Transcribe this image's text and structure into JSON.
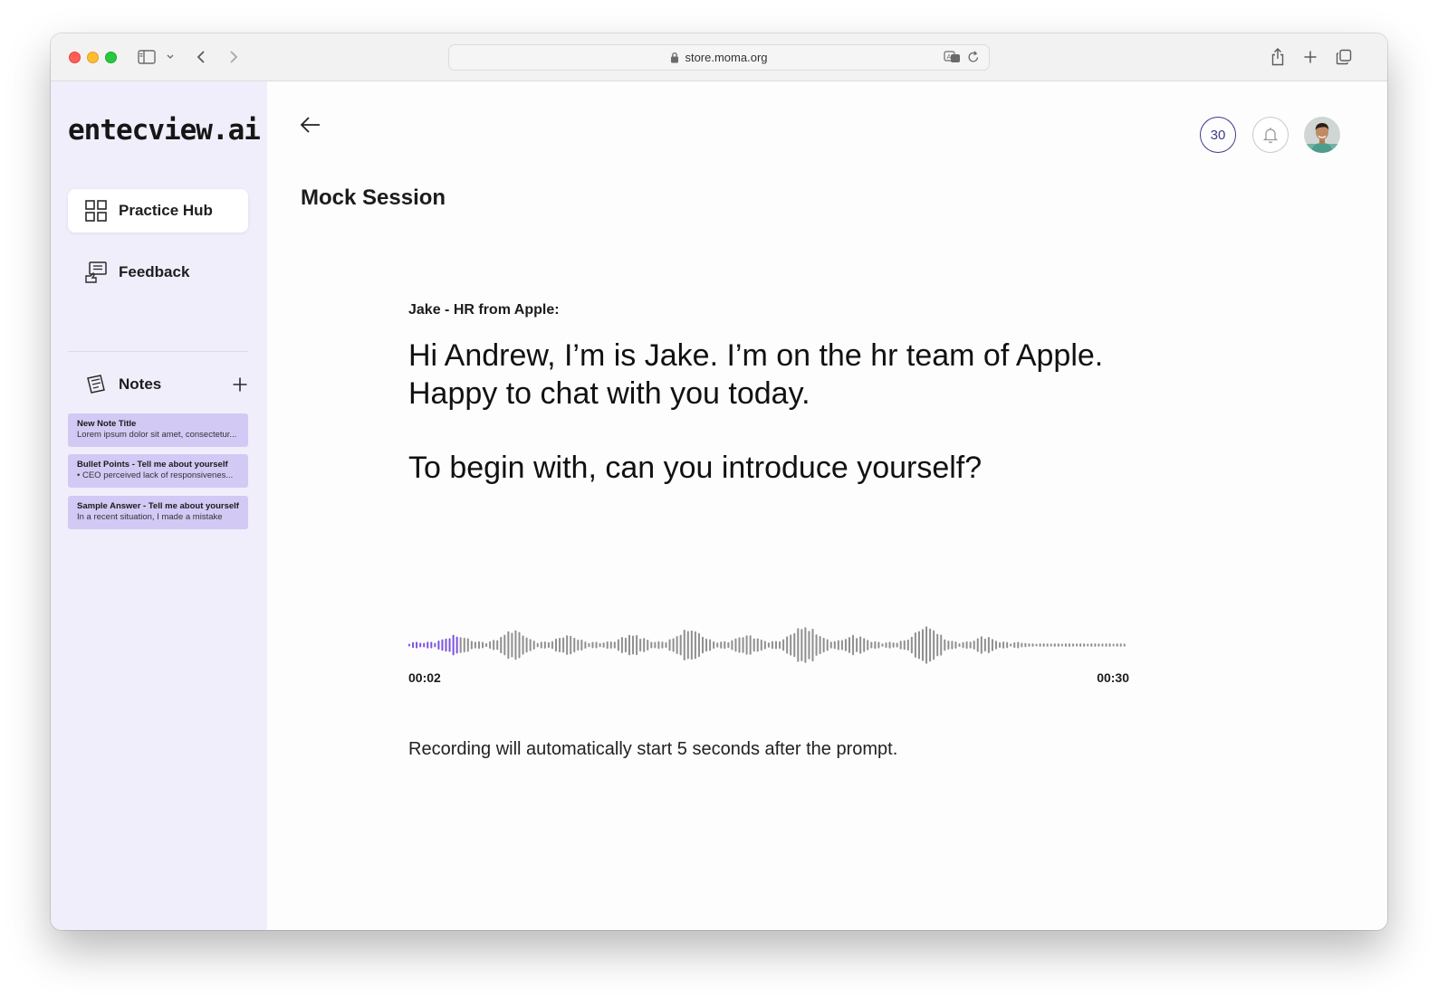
{
  "browser": {
    "url": "store.moma.org"
  },
  "sidebar": {
    "logo": "entecview.ai",
    "nav": [
      {
        "label": "Practice Hub",
        "icon": "grid-icon",
        "active": true
      },
      {
        "label": "Feedback",
        "icon": "feedback-icon",
        "active": false
      }
    ],
    "notes_label": "Notes",
    "notes": [
      {
        "title": "New Note Title",
        "body": "Lorem ipsum dolor sit amet, consectetur..."
      },
      {
        "title": "Bullet Points - Tell me about yourself",
        "body": "•  CEO perceived lack of responsivenes..."
      },
      {
        "title": "Sample Answer - Tell me about yourself",
        "body": "In a recent situation, I made a mistake"
      }
    ]
  },
  "header": {
    "credits": "30"
  },
  "main": {
    "title": "Mock Session",
    "speaker": "Jake - HR from Apple:",
    "prompt_line1": "Hi Andrew, I’m is Jake. I’m on the hr team of Apple.",
    "prompt_line2": "Happy to chat with you today.",
    "prompt_line3": "To begin with, can you introduce yourself?",
    "elapsed": "00:02",
    "total": "00:30",
    "progress_fraction": 0.067,
    "recording_note": "Recording will automatically start 5 seconds after the prompt."
  },
  "colors": {
    "accent": "#7b52e0",
    "sidebar_bg": "#f1eefc",
    "note_card": "#d3c9f5",
    "badge": "#3d3a8c"
  }
}
